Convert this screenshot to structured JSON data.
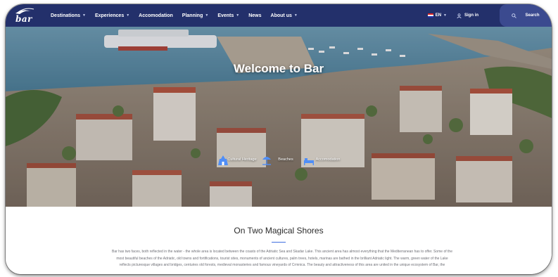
{
  "header": {
    "logo_text": "bar",
    "nav": [
      {
        "label": "Destinations",
        "has_caret": true
      },
      {
        "label": "Experiences",
        "has_caret": true
      },
      {
        "label": "Accomodation",
        "has_caret": false
      },
      {
        "label": "Planning",
        "has_caret": true
      },
      {
        "label": "Events",
        "has_caret": true
      },
      {
        "label": "News",
        "has_caret": false
      },
      {
        "label": "About us",
        "has_caret": true
      }
    ],
    "caret_glyph": "▼",
    "language": "EN",
    "signin": "Sign in",
    "search": "Search"
  },
  "hero": {
    "title": "Welcome to Bar",
    "quick_links": [
      {
        "label": "Cultural Heritage",
        "icon": "heritage-icon"
      },
      {
        "label": "Beaches",
        "icon": "palm-umbrella-icon"
      },
      {
        "label": "Accomodation",
        "icon": "bed-icon"
      }
    ],
    "scroll_glyph": "⌄"
  },
  "content": {
    "title": "On Two Magical Shores",
    "paragraph": "Bar has two faces, both reflected in the water - the whole area is located between the coasts of the Adriatic Sea and Skadar Lake. This ancient area has almost everything that the Mediterranean has to offer. Some of the most beautiful beaches of the Adriatic, old towns and fortifications, tourist sites, monuments of ancient cultures, palm trees, hotels, marinas are bathed in the brilliant Adriatic light. The warm, green water of the Lake reflects picturesque villages and bridges, centuries old forests, medieval monasteries and famous vineyards of Crmnica. The beauty and attractiveness of this area are united in the unique ecosystem of Bar, the"
  },
  "colors": {
    "header_bg": "#23306b",
    "accent": "#3f6fe0",
    "search_bg": "#3b4a8f"
  }
}
